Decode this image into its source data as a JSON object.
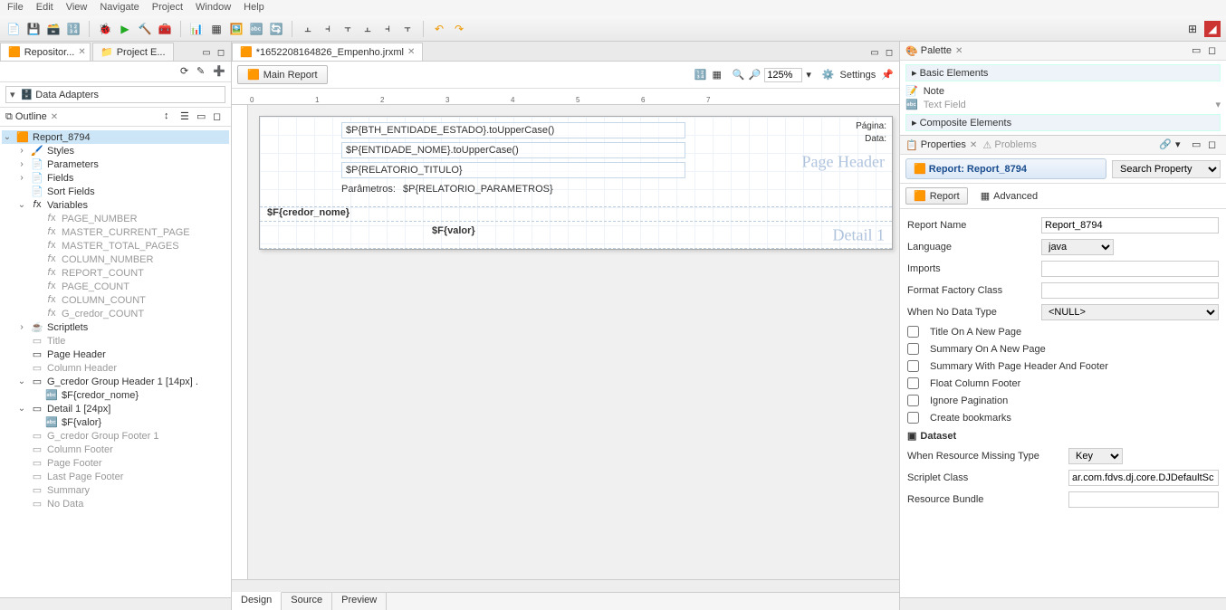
{
  "menu": [
    "File",
    "Edit",
    "View",
    "Navigate",
    "Project",
    "Window",
    "Help"
  ],
  "left": {
    "tabs": [
      {
        "label": "Repositor...",
        "icon": "🟧"
      },
      {
        "label": "Project E...",
        "icon": "📁"
      }
    ],
    "data_adapters": "Data Adapters",
    "outline": {
      "title": "Outline",
      "root": "Report_8794",
      "nodes": [
        {
          "label": "Styles",
          "indent": 1,
          "icon": "🖌️",
          "tw": "›"
        },
        {
          "label": "Parameters",
          "indent": 1,
          "icon": "📄",
          "tw": "›"
        },
        {
          "label": "Fields",
          "indent": 1,
          "icon": "📄",
          "tw": "›"
        },
        {
          "label": "Sort Fields",
          "indent": 1,
          "icon": "📄",
          "tw": ""
        },
        {
          "label": "Variables",
          "indent": 1,
          "icon": "𝑓x",
          "tw": "⌄"
        },
        {
          "label": "PAGE_NUMBER",
          "indent": 2,
          "icon": "𝑓x",
          "dim": true
        },
        {
          "label": "MASTER_CURRENT_PAGE",
          "indent": 2,
          "icon": "𝑓x",
          "dim": true
        },
        {
          "label": "MASTER_TOTAL_PAGES",
          "indent": 2,
          "icon": "𝑓x",
          "dim": true
        },
        {
          "label": "COLUMN_NUMBER",
          "indent": 2,
          "icon": "𝑓x",
          "dim": true
        },
        {
          "label": "REPORT_COUNT",
          "indent": 2,
          "icon": "𝑓x",
          "dim": true
        },
        {
          "label": "PAGE_COUNT",
          "indent": 2,
          "icon": "𝑓x",
          "dim": true
        },
        {
          "label": "COLUMN_COUNT",
          "indent": 2,
          "icon": "𝑓x",
          "dim": true
        },
        {
          "label": "G_credor_COUNT",
          "indent": 2,
          "icon": "𝑓x",
          "dim": true
        },
        {
          "label": "Scriptlets",
          "indent": 1,
          "icon": "☕",
          "tw": "›"
        },
        {
          "label": "Title",
          "indent": 1,
          "icon": "▭",
          "dim": true
        },
        {
          "label": "Page Header",
          "indent": 1,
          "icon": "▭"
        },
        {
          "label": "Column Header",
          "indent": 1,
          "icon": "▭",
          "dim": true
        },
        {
          "label": "G_credor Group Header 1 [14px] .",
          "indent": 1,
          "icon": "▭",
          "tw": "⌄"
        },
        {
          "label": "$F{credor_nome}",
          "indent": 2,
          "icon": "🔤"
        },
        {
          "label": "Detail 1 [24px]",
          "indent": 1,
          "icon": "▭",
          "tw": "⌄"
        },
        {
          "label": "$F{valor}",
          "indent": 2,
          "icon": "🔤"
        },
        {
          "label": "G_credor Group Footer 1",
          "indent": 1,
          "icon": "▭",
          "dim": true
        },
        {
          "label": "Column Footer",
          "indent": 1,
          "icon": "▭",
          "dim": true
        },
        {
          "label": "Page Footer",
          "indent": 1,
          "icon": "▭",
          "dim": true
        },
        {
          "label": "Last Page Footer",
          "indent": 1,
          "icon": "▭",
          "dim": true
        },
        {
          "label": "Summary",
          "indent": 1,
          "icon": "▭",
          "dim": true
        },
        {
          "label": "No Data",
          "indent": 1,
          "icon": "▭",
          "dim": true
        }
      ]
    }
  },
  "center": {
    "file_tab": "*1652208164826_Empenho.jrxml",
    "main_report_tab": "Main Report",
    "zoom": "125%",
    "settings": "Settings",
    "page_header_label": "Page Header",
    "detail_label": "Detail 1",
    "fields": {
      "entidade_estado": "$P{BTH_ENTIDADE_ESTADO}.toUpperCase()",
      "entidade_nome": "$P{ENTIDADE_NOME}.toUpperCase()",
      "relatorio_titulo": "$P{RELATORIO_TITULO}",
      "parametros_label": "Parâmetros:",
      "parametros": "$P{RELATORIO_PARAMETROS}",
      "credor": "$F{credor_nome}",
      "valor": "$F{valor}"
    },
    "pagina": "Página:",
    "data": "Data:",
    "bottom_tabs": [
      "Design",
      "Source",
      "Preview"
    ]
  },
  "right": {
    "palette": {
      "title": "Palette",
      "basic": "Basic Elements",
      "note": "Note",
      "text_field": "Text Field",
      "composite": "Composite Elements"
    },
    "properties": {
      "tab_properties": "Properties",
      "tab_problems": "Problems",
      "title": "Report: Report_8794",
      "search": "Search Property",
      "mode_report": "Report",
      "mode_advanced": "Advanced",
      "fields": {
        "report_name": {
          "label": "Report Name",
          "value": "Report_8794"
        },
        "language": {
          "label": "Language",
          "value": "java"
        },
        "imports": {
          "label": "Imports",
          "value": ""
        },
        "format_factory": {
          "label": "Format Factory Class",
          "value": ""
        },
        "when_no_data": {
          "label": "When No Data Type",
          "value": "<NULL>"
        },
        "title_new_page": "Title On A New Page",
        "summary_new_page": "Summary On A New Page",
        "summary_header_footer": "Summary With Page Header And Footer",
        "float_column_footer": "Float Column Footer",
        "ignore_pagination": "Ignore Pagination",
        "create_bookmarks": "Create bookmarks",
        "dataset": "Dataset",
        "missing_type": {
          "label": "When Resource Missing Type",
          "value": "Key"
        },
        "scriptlet": {
          "label": "Scriplet Class",
          "value": "ar.com.fdvs.dj.core.DJDefaultSc"
        },
        "resource_bundle": {
          "label": "Resource Bundle",
          "value": ""
        }
      }
    }
  }
}
